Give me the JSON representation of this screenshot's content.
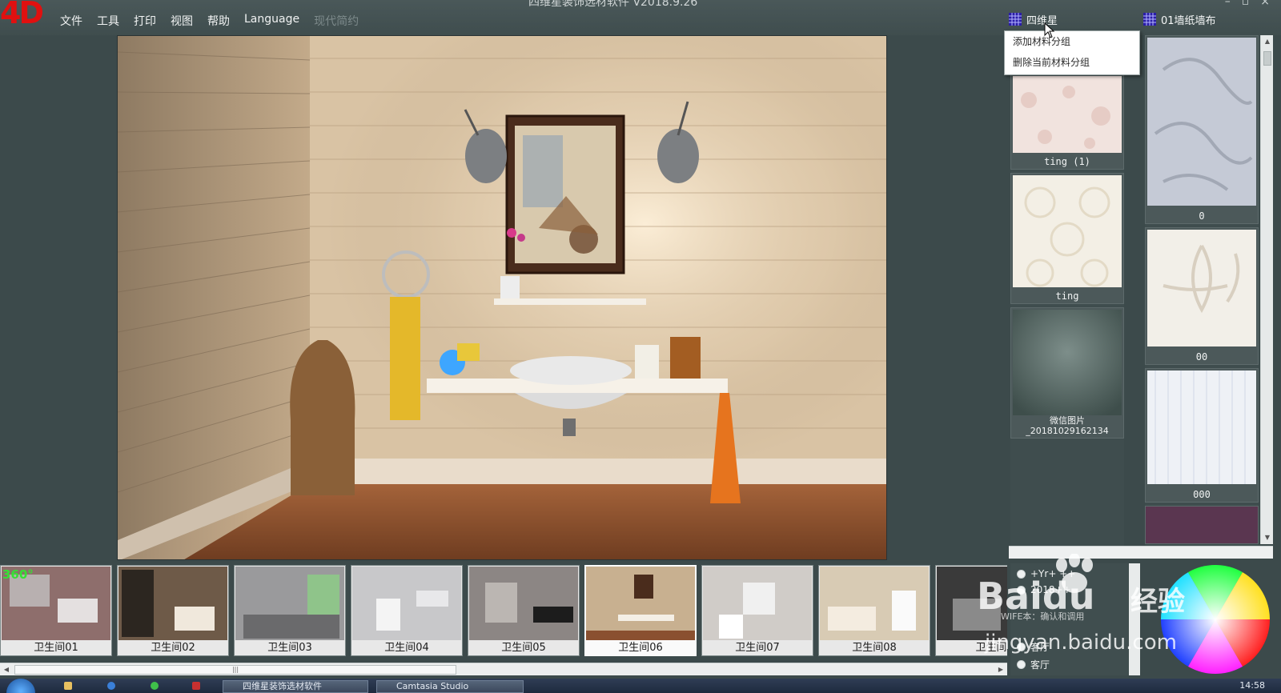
{
  "app": {
    "logo": "4D",
    "window_title": "四维星装饰选材软件  V2018.9.26"
  },
  "menu": [
    {
      "label": "文件",
      "enabled": true
    },
    {
      "label": "工具",
      "enabled": true
    },
    {
      "label": "打印",
      "enabled": true
    },
    {
      "label": "视图",
      "enabled": true
    },
    {
      "label": "帮助",
      "enabled": true
    },
    {
      "label": "Language",
      "enabled": true
    },
    {
      "label": "现代简约",
      "enabled": false
    }
  ],
  "material_groups": {
    "left": {
      "label": "四维星",
      "icon": "grid-icon"
    },
    "right": {
      "label": "01墙纸墙布",
      "icon": "grid-icon"
    }
  },
  "context_menu": {
    "items": [
      "添加材料分组",
      "删除当前材料分组"
    ]
  },
  "left_swatches": [
    {
      "label": "ting (1)"
    },
    {
      "label": "ting"
    },
    {
      "label_line1": "微信图片",
      "label_line2": "_20181029162134"
    }
  ],
  "right_swatches": [
    {
      "label": "0"
    },
    {
      "label": "00"
    },
    {
      "label": "000"
    }
  ],
  "scenes": [
    {
      "label": "卫生间01",
      "badge": "360°"
    },
    {
      "label": "卫生间02"
    },
    {
      "label": "卫生间03"
    },
    {
      "label": "卫生间04"
    },
    {
      "label": "卫生间05"
    },
    {
      "label": "卫生间06",
      "selected": true
    },
    {
      "label": "卫生间07"
    },
    {
      "label": "卫生间08"
    },
    {
      "label": "卫生间"
    }
  ],
  "room_options": [
    {
      "label": "+Yr+ ++"
    },
    {
      "label": "2018++"
    },
    {
      "label": "客厅"
    },
    {
      "label": "客厅"
    }
  ],
  "watermark": {
    "brand": "Baidu",
    "brand_cn": "经验",
    "url": "jingyan.baidu.com",
    "sub": "WIFE本：确认和调用"
  },
  "taskbar": {
    "tasks": [
      "四维星装饰选材软件",
      "Camtasia Studio"
    ],
    "clock": "14:58"
  },
  "colors": {
    "panel_bg": "#3f4d4e",
    "accent_red": "#e01010",
    "badge_green": "#37e036"
  }
}
